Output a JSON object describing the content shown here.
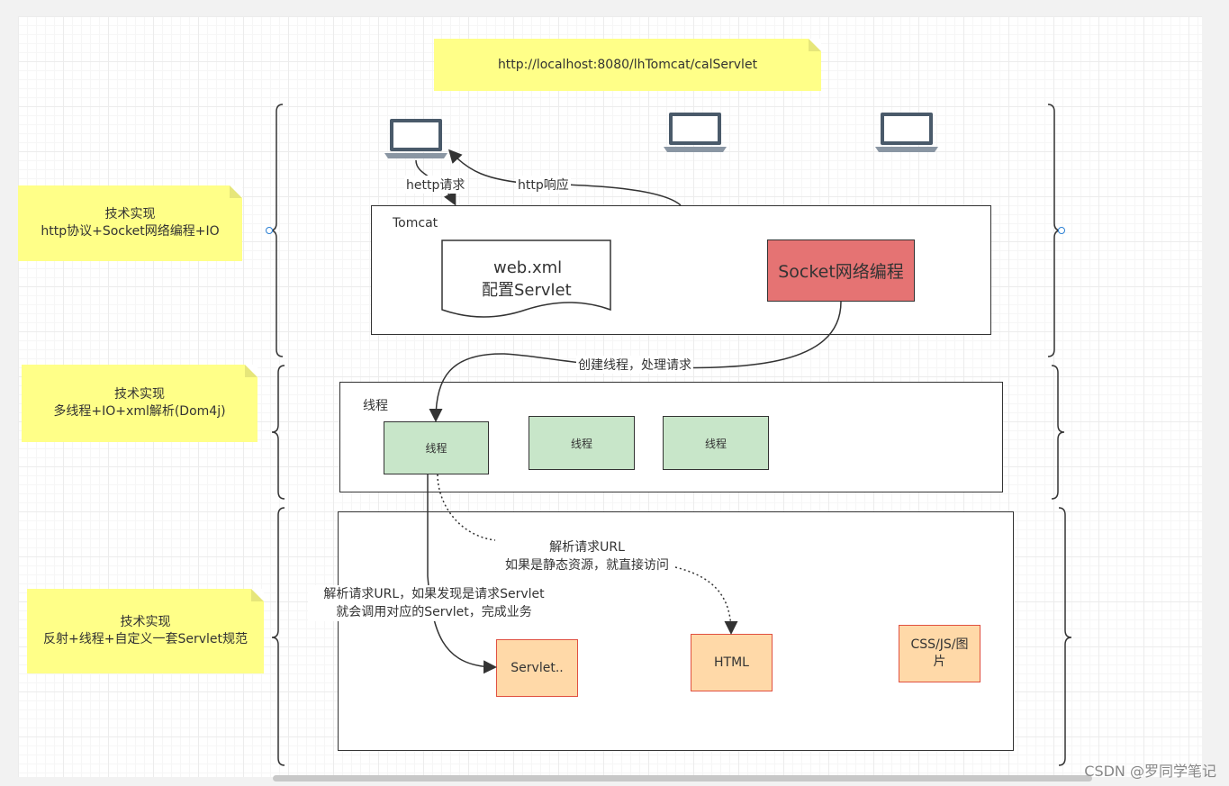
{
  "url_note": "http://localhost:8080/lhTomcat/calServlet",
  "notes": [
    {
      "line1": "技术实现",
      "line2": "http协议+Socket网络编程+IO"
    },
    {
      "line1": "技术实现",
      "line2": "多线程+IO+xml解析(Dom4j)"
    },
    {
      "line1": "技术实现",
      "line2": "反射+线程+自定义一套Servlet规范"
    }
  ],
  "tomcat": {
    "title": "Tomcat",
    "webxml_line1": "web.xml",
    "webxml_line2": "配置Servlet",
    "socket": "Socket网络编程"
  },
  "threads": {
    "title": "线程",
    "items": [
      "线程",
      "线程",
      "线程"
    ]
  },
  "resources": {
    "servlet": "Servlet..",
    "html": "HTML",
    "static_line1": "CSS/JS/图",
    "static_line2": "片"
  },
  "edges": {
    "request": "hettp请求",
    "response": "http响应",
    "create_thread": "创建线程，处理请求",
    "parse_static_line1": "解析请求URL",
    "parse_static_line2": "如果是静态资源，就直接访问",
    "parse_servlet_line1": "解析请求URL，如果发现是请求Servlet",
    "parse_servlet_line2": "就会调用对应的Servlet，完成业务"
  },
  "icons": [
    "laptop-icon",
    "laptop-icon",
    "laptop-icon"
  ],
  "watermark": "CSDN @罗同学笔记",
  "colors": {
    "note": "#ffff88",
    "thread": "#c8e6c9",
    "socket": "#e57373",
    "resource_fill": "#ffd9a8",
    "resource_border": "#e05040"
  }
}
